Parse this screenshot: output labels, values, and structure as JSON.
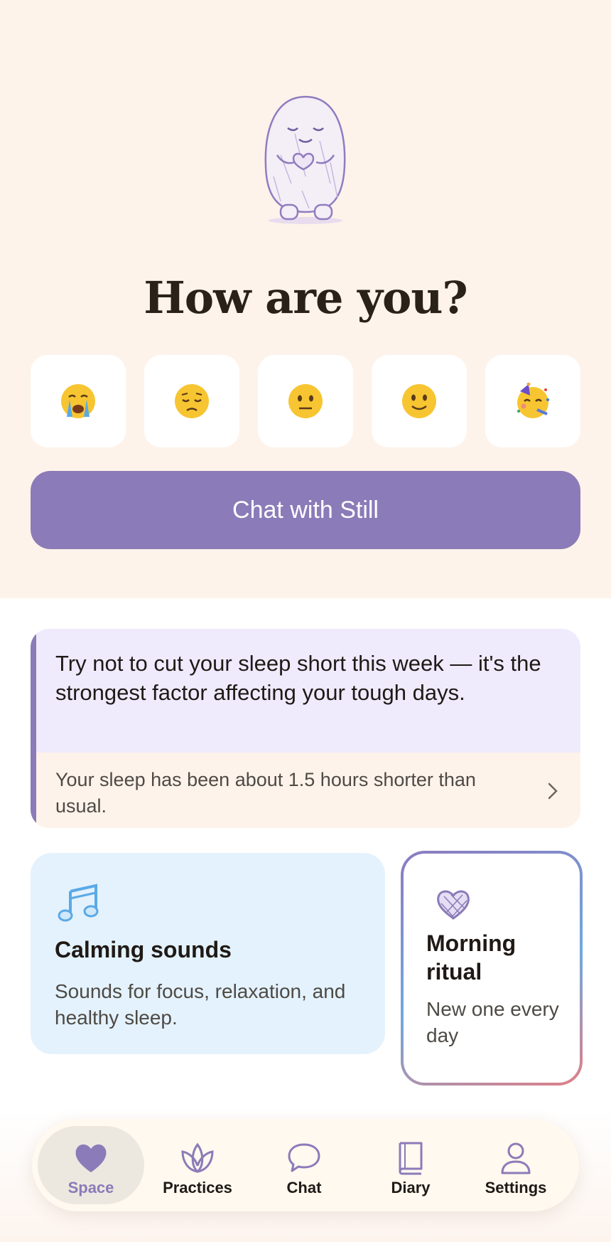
{
  "hero": {
    "title": "How are you?",
    "mood_options": [
      "loudly-crying-face",
      "pensive-face",
      "neutral-face",
      "slightly-smiling-face",
      "partying-face"
    ],
    "chat_button_label": "Chat with Still"
  },
  "insight": {
    "headline": "Try not to cut your sleep short this week — it's the strongest factor affecting your tough days.",
    "detail": "Your sleep has been about 1.5 hours shorter than usual."
  },
  "cards": {
    "sounds": {
      "title": "Calming sounds",
      "description": "Sounds for focus, relaxation, and healthy sleep.",
      "icon": "music-notes-icon"
    },
    "ritual": {
      "title": "Morning ritual",
      "description": "New one every day",
      "icon": "heart-icon"
    }
  },
  "tabbar": {
    "active": "Space",
    "items": [
      {
        "label": "Space",
        "icon": "heart-icon"
      },
      {
        "label": "Practices",
        "icon": "lotus-icon"
      },
      {
        "label": "Chat",
        "icon": "speech-bubble-icon"
      },
      {
        "label": "Diary",
        "icon": "book-icon"
      },
      {
        "label": "Settings",
        "icon": "person-icon"
      }
    ]
  },
  "colors": {
    "accent": "#8b7bb8",
    "hero_bg": "#fef3ea",
    "insight_bg": "#efeafc",
    "sounds_bg": "#e4f2fd",
    "text": "#1f1a16"
  }
}
